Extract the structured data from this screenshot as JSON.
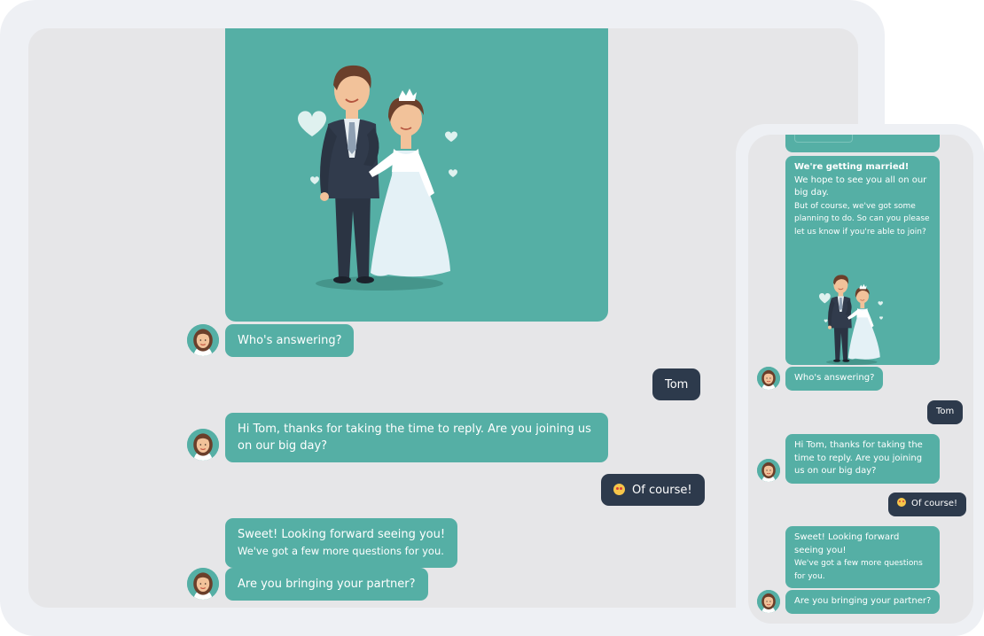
{
  "tablet": {
    "messages": {
      "who_answering": "Who's answering?",
      "tom": "Tom",
      "hi_tom": "Hi Tom, thanks for taking the time to reply. Are you joining us on our big day?",
      "of_course": "Of course!",
      "sweet_1": "Sweet! Looking forward seeing you!",
      "sweet_2": "We've got a few more questions for you.",
      "partner": "Are you bringing your partner?"
    }
  },
  "phone": {
    "messages": {
      "invite_title": "We're getting married!",
      "invite_line": "We hope to see you all on our big day.",
      "invite_small": "But of course, we've got some planning to do. So can you please let us know if you're able to join?",
      "who_answering": "Who's answering?",
      "tom": "Tom",
      "hi_tom": "Hi Tom, thanks for taking the time to reply. Are you joining us on our big day?",
      "of_course": "Of course!",
      "sweet_1": "Sweet! Looking forward seeing you!",
      "sweet_2": "We've got a few more questions for you.",
      "partner": "Are you bringing your partner?"
    }
  },
  "icons": {
    "bot_avatar": "woman-avatar-icon",
    "emoji": "heart-eyes-emoji-icon",
    "illustration": "wedding-couple-illustration"
  },
  "colors": {
    "bot_bubble": "#55afa5",
    "user_bubble": "#2d3a4c",
    "chat_background": "#e6e6e8",
    "device_frame": "#eef0f4"
  }
}
